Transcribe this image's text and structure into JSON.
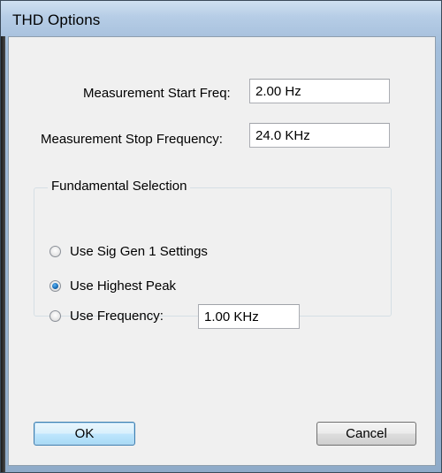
{
  "window": {
    "title": "THD Options"
  },
  "measurement": {
    "start_label": "Measurement Start Freq:",
    "start_value": "2.00 Hz",
    "stop_label": "Measurement Stop Frequency:",
    "stop_value": "24.0 KHz"
  },
  "fundamental": {
    "group_label": "Fundamental Selection",
    "options": [
      {
        "label": "Use Sig Gen 1 Settings",
        "selected": false
      },
      {
        "label": "Use Highest Peak",
        "selected": true
      },
      {
        "label": "Use Frequency:",
        "selected": false
      }
    ],
    "frequency_value": "1.00 KHz"
  },
  "buttons": {
    "ok": "OK",
    "cancel": "Cancel"
  }
}
